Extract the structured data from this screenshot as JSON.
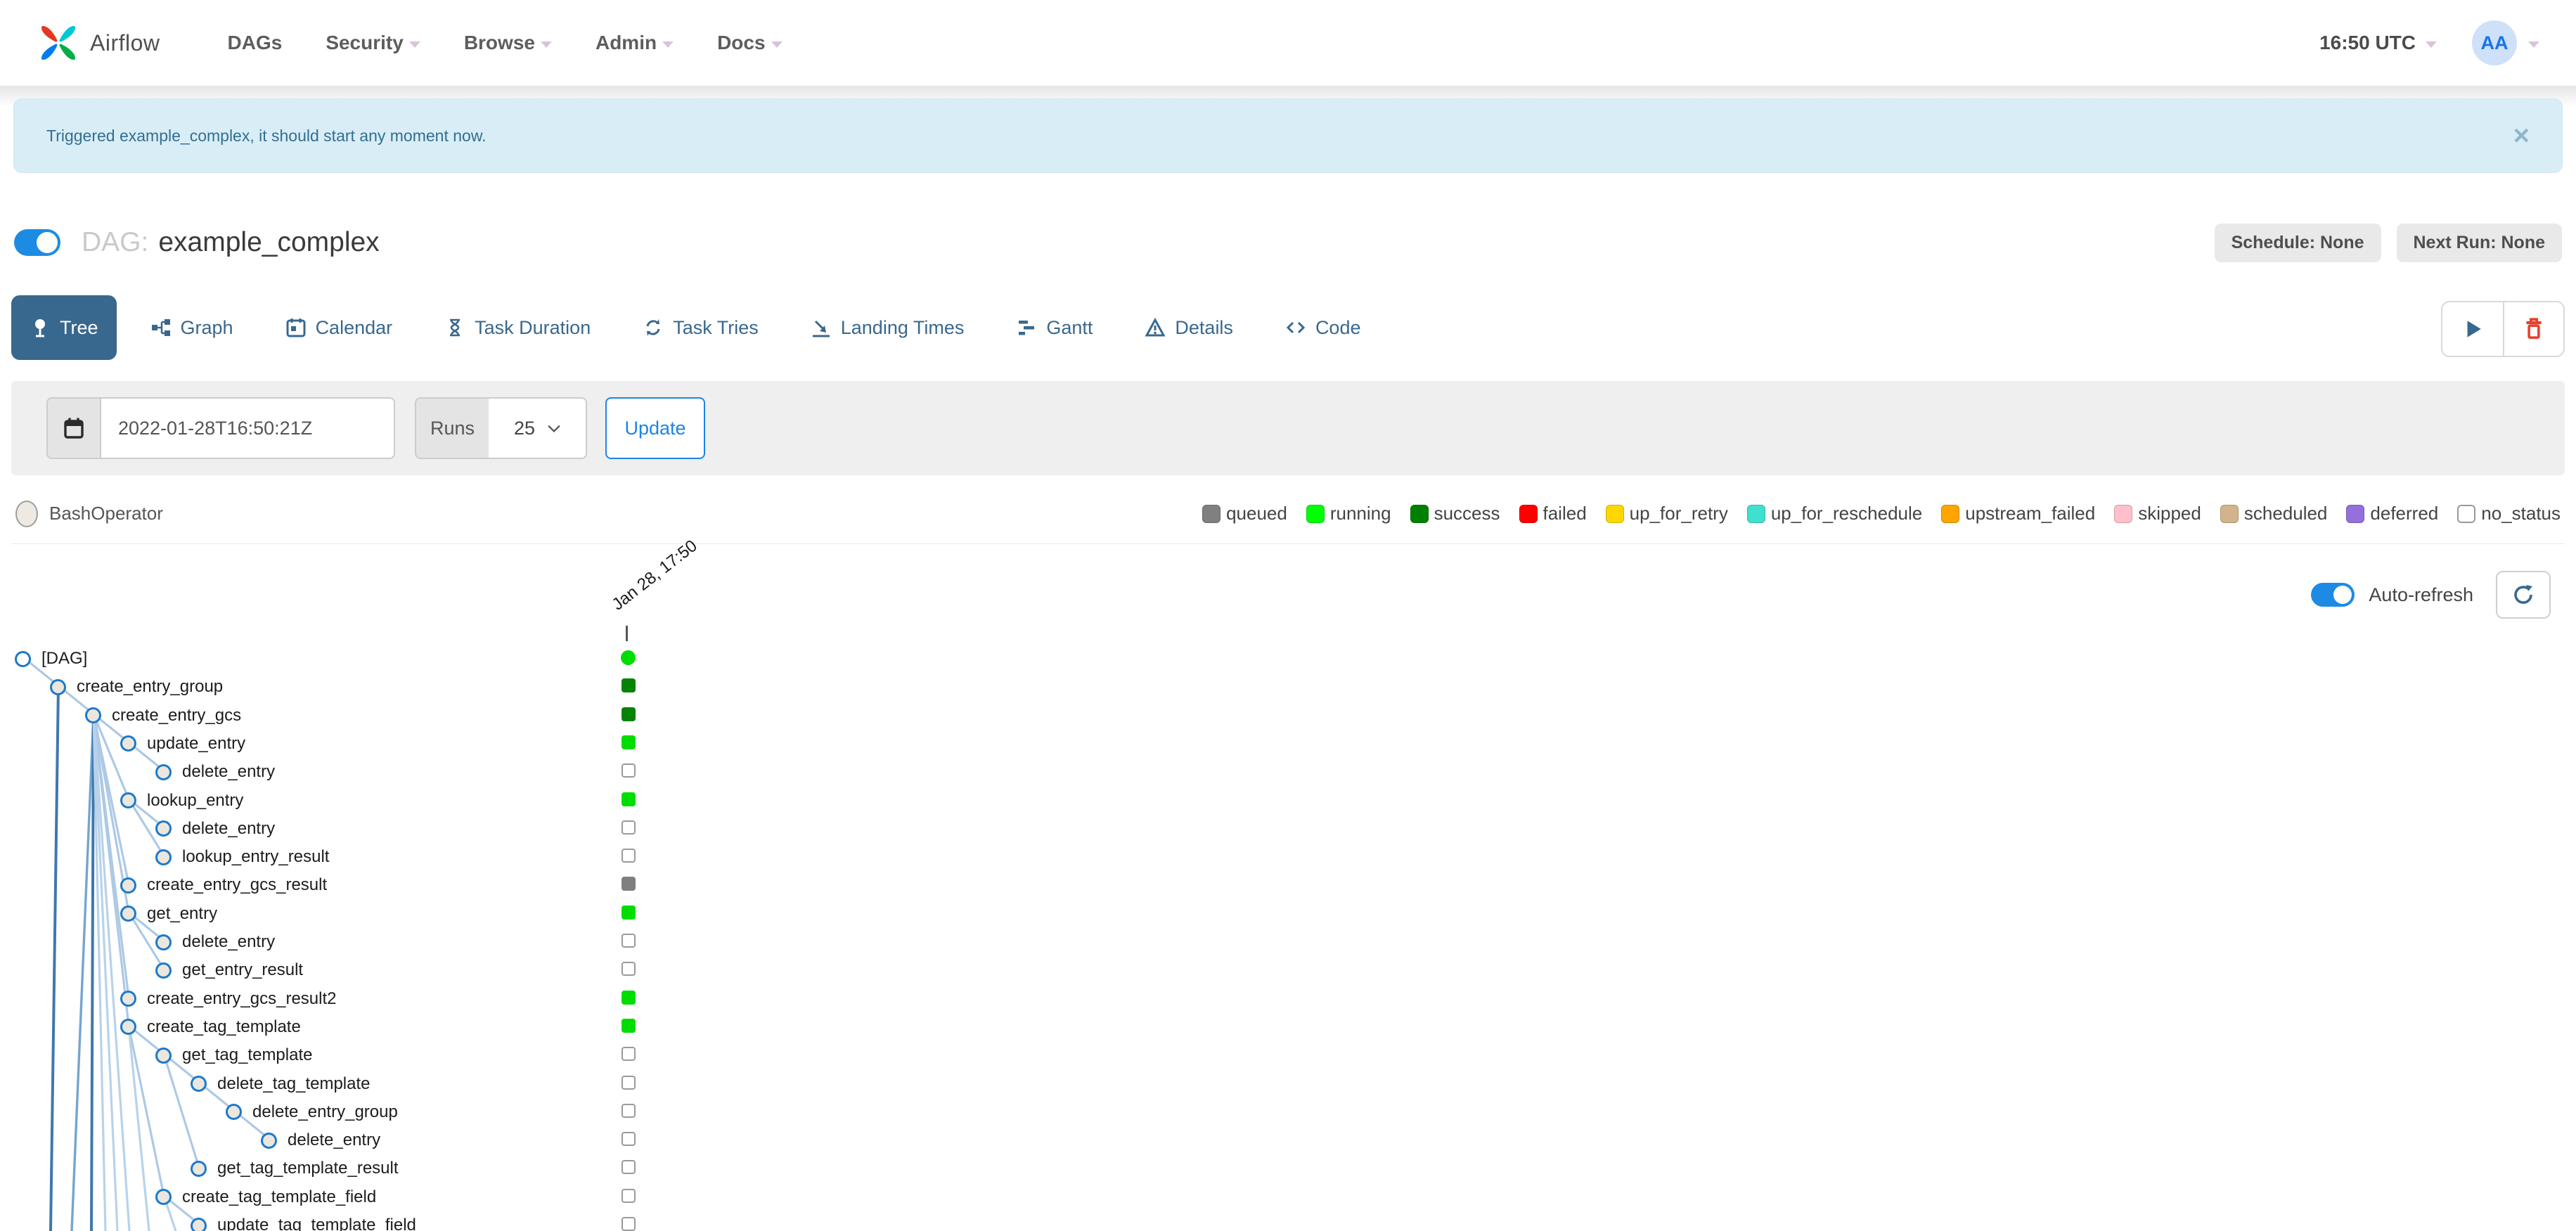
{
  "navbar": {
    "brand": "Airflow",
    "items": [
      {
        "label": "DAGs",
        "caret": false
      },
      {
        "label": "Security",
        "caret": true
      },
      {
        "label": "Browse",
        "caret": true
      },
      {
        "label": "Admin",
        "caret": true
      },
      {
        "label": "Docs",
        "caret": true
      }
    ],
    "clock": "16:50 UTC",
    "avatar_initials": "AA"
  },
  "alert": {
    "message": "Triggered example_complex, it should start any moment now.",
    "close_label": "×"
  },
  "dag_header": {
    "prefix": "DAG:",
    "name": "example_complex",
    "pause_toggle_on": true,
    "schedule_badge": "Schedule: None",
    "next_run_badge": "Next Run: None"
  },
  "tabs": [
    {
      "label": "Tree",
      "active": true
    },
    {
      "label": "Graph",
      "active": false
    },
    {
      "label": "Calendar",
      "active": false
    },
    {
      "label": "Task Duration",
      "active": false
    },
    {
      "label": "Task Tries",
      "active": false
    },
    {
      "label": "Landing Times",
      "active": false
    },
    {
      "label": "Gantt",
      "active": false
    },
    {
      "label": "Details",
      "active": false
    },
    {
      "label": "Code",
      "active": false
    }
  ],
  "filter": {
    "date_value": "2022-01-28T16:50:21Z",
    "runs_label": "Runs",
    "runs_value": "25",
    "update_label": "Update"
  },
  "legend": {
    "operator": "BashOperator",
    "statuses": [
      {
        "label": "queued",
        "color": "#808080"
      },
      {
        "label": "running",
        "color": "#00ff00"
      },
      {
        "label": "success",
        "color": "#008000"
      },
      {
        "label": "failed",
        "color": "#ff0000"
      },
      {
        "label": "up_for_retry",
        "color": "#ffd700"
      },
      {
        "label": "up_for_reschedule",
        "color": "#40e0d0"
      },
      {
        "label": "upstream_failed",
        "color": "#ffa500"
      },
      {
        "label": "skipped",
        "color": "#ffc0cb"
      },
      {
        "label": "scheduled",
        "color": "#d2b48c"
      },
      {
        "label": "deferred",
        "color": "#9370db"
      },
      {
        "label": "no_status",
        "color": "#ffffff"
      }
    ]
  },
  "auto_refresh": {
    "label": "Auto-refresh",
    "on": true
  },
  "tree": {
    "run_label": "Jan 28, 17:50",
    "status_colors": {
      "running": "#00dd00",
      "success": "#048304",
      "queued": "#7f7f7f",
      "none": "#ffffff"
    },
    "nodes": [
      {
        "label": "[DAG]",
        "level": 0,
        "status": "running",
        "shape": "circle"
      },
      {
        "label": "create_entry_group",
        "level": 1,
        "status": "success",
        "shape": "square"
      },
      {
        "label": "create_entry_gcs",
        "level": 2,
        "status": "success",
        "shape": "square"
      },
      {
        "label": "update_entry",
        "level": 3,
        "status": "running",
        "shape": "square"
      },
      {
        "label": "delete_entry",
        "level": 4,
        "status": "none",
        "shape": "square"
      },
      {
        "label": "lookup_entry",
        "level": 3,
        "status": "running",
        "shape": "square"
      },
      {
        "label": "delete_entry",
        "level": 4,
        "status": "none",
        "shape": "square"
      },
      {
        "label": "lookup_entry_result",
        "level": 4,
        "status": "none",
        "shape": "square"
      },
      {
        "label": "create_entry_gcs_result",
        "level": 3,
        "status": "queued",
        "shape": "square"
      },
      {
        "label": "get_entry",
        "level": 3,
        "status": "running",
        "shape": "square"
      },
      {
        "label": "delete_entry",
        "level": 4,
        "status": "none",
        "shape": "square"
      },
      {
        "label": "get_entry_result",
        "level": 4,
        "status": "none",
        "shape": "square"
      },
      {
        "label": "create_entry_gcs_result2",
        "level": 3,
        "status": "running",
        "shape": "square"
      },
      {
        "label": "create_tag_template",
        "level": 3,
        "status": "running",
        "shape": "square"
      },
      {
        "label": "get_tag_template",
        "level": 4,
        "status": "none",
        "shape": "square"
      },
      {
        "label": "delete_tag_template",
        "level": 5,
        "status": "none",
        "shape": "square"
      },
      {
        "label": "delete_entry_group",
        "level": 6,
        "status": "none",
        "shape": "square"
      },
      {
        "label": "delete_entry",
        "level": 7,
        "status": "none",
        "shape": "square"
      },
      {
        "label": "get_tag_template_result",
        "level": 5,
        "status": "none",
        "shape": "square"
      },
      {
        "label": "create_tag_template_field",
        "level": 4,
        "status": "none",
        "shape": "square"
      },
      {
        "label": "update_tag_template_field",
        "level": 5,
        "status": "none",
        "shape": "square"
      }
    ],
    "edges": [
      [
        0,
        1
      ],
      [
        1,
        2
      ],
      [
        2,
        3
      ],
      [
        3,
        4
      ],
      [
        2,
        5
      ],
      [
        5,
        6
      ],
      [
        5,
        7
      ],
      [
        2,
        8
      ],
      [
        2,
        9
      ],
      [
        9,
        10
      ],
      [
        9,
        11
      ],
      [
        2,
        12
      ],
      [
        2,
        13
      ],
      [
        13,
        14
      ],
      [
        14,
        15
      ],
      [
        15,
        16
      ],
      [
        16,
        17
      ],
      [
        14,
        18
      ],
      [
        13,
        19
      ],
      [
        19,
        20
      ]
    ]
  }
}
